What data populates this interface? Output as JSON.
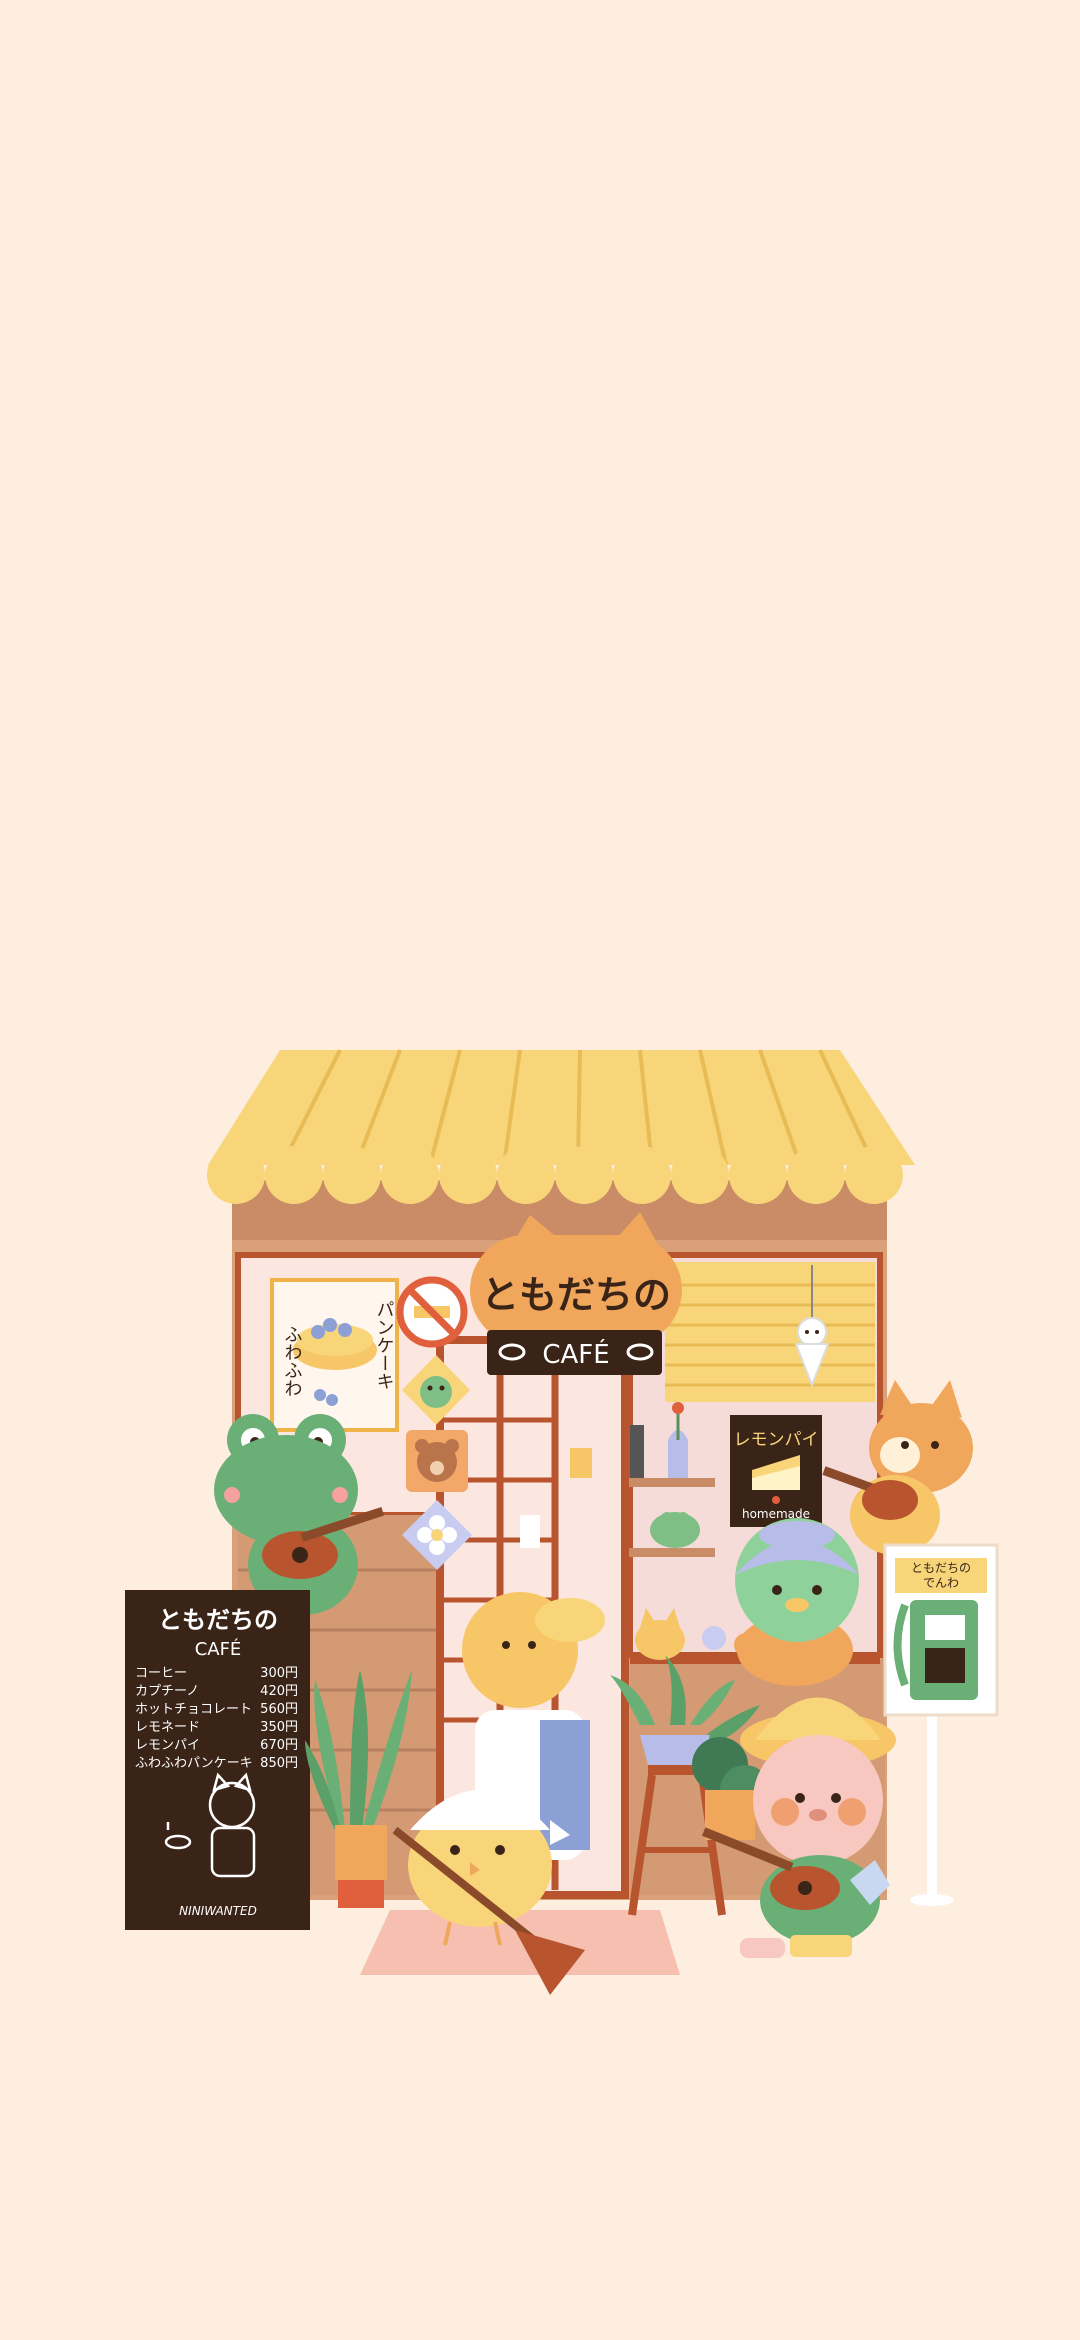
{
  "wallpaper": {
    "background_color": "#fdeee0",
    "illustration": "cute animals cafe storefront"
  },
  "cafe": {
    "sign_title": "ともだちの",
    "sign_subtitle": "CAFÉ",
    "awning_color": "#f9d57a",
    "wall_color": "#d9a07a"
  },
  "window_poster": {
    "vertical_text_1": "パンケーキ",
    "vertical_text_2": "ふわふわ"
  },
  "lemon_pie_poster": {
    "title": "レモンパイ",
    "caption": "homemade"
  },
  "menu_board": {
    "title_line1": "ともだちの",
    "title_line2": "CAFÉ",
    "items": [
      {
        "name": "コーヒー",
        "price": "300円"
      },
      {
        "name": "カプチーノ",
        "price": "420円"
      },
      {
        "name": "ホットチョコレート",
        "price": "560円"
      },
      {
        "name": "レモネード",
        "price": "350円"
      },
      {
        "name": "レモンパイ",
        "price": "670円"
      },
      {
        "name": "ふわふわパンケーキ",
        "price": "850円"
      }
    ],
    "credit": "NINIWANTED"
  },
  "phone_booth": {
    "sign_line1": "ともだちの",
    "sign_line2": "でんわ"
  },
  "characters": [
    "frog-ukulele",
    "cat-guitar",
    "kappa",
    "chick-sweeping",
    "pig-ukulele",
    "bear-barista"
  ],
  "icons": [
    "no-smoking-icon",
    "frog-icon",
    "bear-icon",
    "flower-icon",
    "coffee-cup-icon",
    "teru-teru-bozu-icon"
  ]
}
